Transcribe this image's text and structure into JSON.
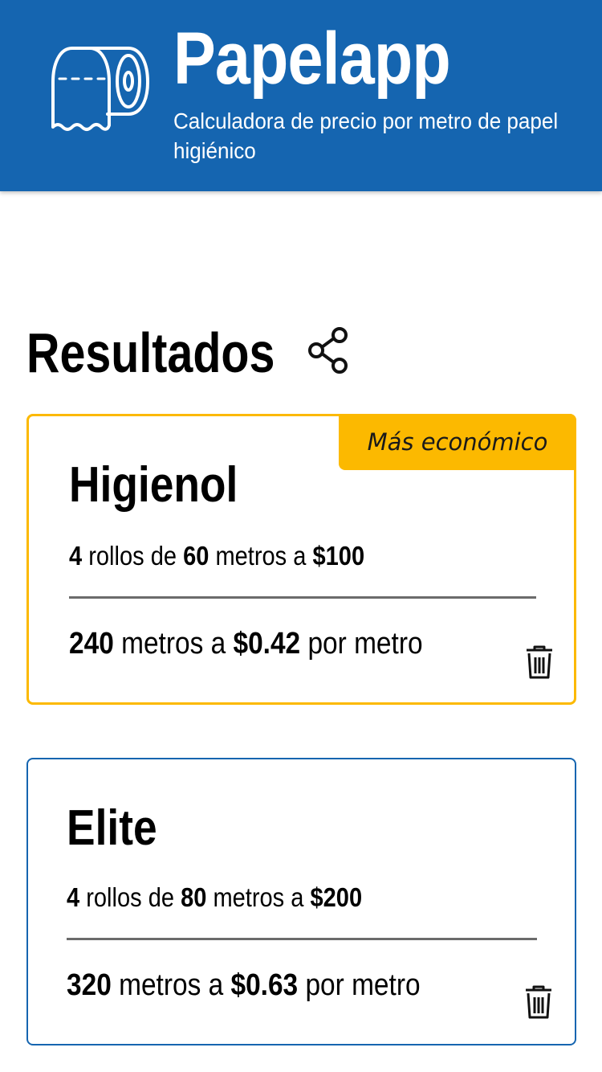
{
  "header": {
    "title": "Papelapp",
    "subtitle": "Calculadora de precio por metro de papel higiénico",
    "bg_color": "#1565b0",
    "logo_icon": "toilet-paper-roll-icon"
  },
  "results": {
    "title": "Resultados",
    "share_icon": "share-icon",
    "best_badge": "Más económico",
    "best_color": "#fcb900",
    "items": [
      {
        "brand": "Higienol",
        "rolls": "4",
        "rolls_label": "rollos de",
        "meters_per_roll": "60",
        "meters_label": "metros a",
        "price": "$100",
        "total_meters": "240",
        "total_meters_label": "metros a",
        "price_per_meter": "$0.42",
        "per_meter_label": "por metro",
        "is_cheapest": true
      },
      {
        "brand": "Elite",
        "rolls": "4",
        "rolls_label": "rollos de",
        "meters_per_roll": "80",
        "meters_label": "metros a",
        "price": "$200",
        "total_meters": "320",
        "total_meters_label": "metros a",
        "price_per_meter": "$0.63",
        "per_meter_label": "por metro",
        "is_cheapest": false
      }
    ]
  }
}
